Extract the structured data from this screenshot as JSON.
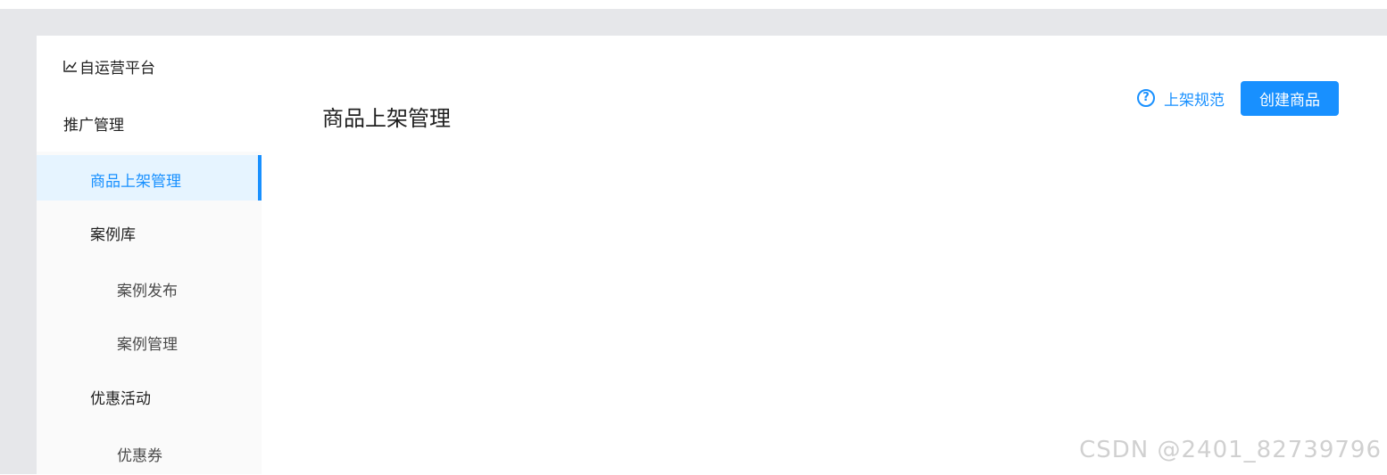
{
  "sidebar": {
    "platform_name": "自运营平台",
    "group_title": "推广管理",
    "items": [
      {
        "label": "商品上架管理",
        "level": 2,
        "active": true
      },
      {
        "label": "案例库",
        "level": 2,
        "active": false
      },
      {
        "label": "案例发布",
        "level": 3,
        "active": false
      },
      {
        "label": "案例管理",
        "level": 3,
        "active": false
      },
      {
        "label": "优惠活动",
        "level": 2,
        "active": false
      },
      {
        "label": "优惠券",
        "level": 3,
        "active": false
      }
    ]
  },
  "main": {
    "page_title": "商品上架管理",
    "help_link_label": "上架规范",
    "create_button_label": "创建商品"
  },
  "watermark": "CSDN @2401_82739796",
  "colors": {
    "accent": "#1890ff",
    "active_bg": "#e6f4ff",
    "page_bg": "#e6e7ea"
  },
  "icons": {
    "logo_icon": "line-chart-icon",
    "help_icon": "question-circle-icon"
  }
}
